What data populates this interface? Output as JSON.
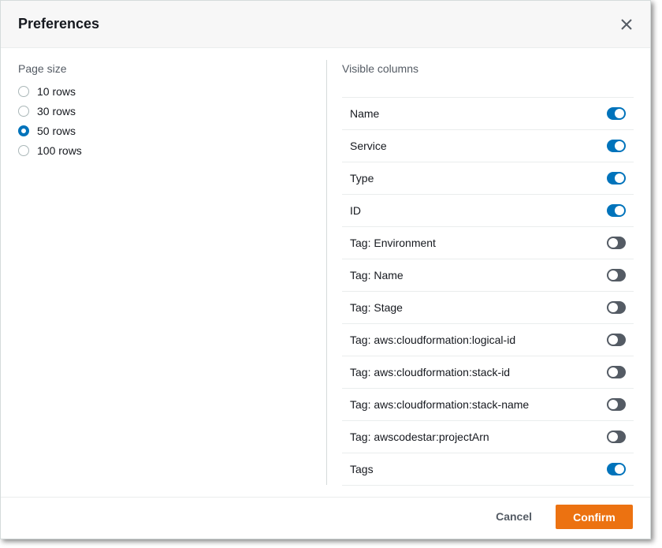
{
  "dialog": {
    "title": "Preferences",
    "close_icon": "close-icon"
  },
  "page_size": {
    "label": "Page size",
    "options": [
      {
        "label": "10 rows",
        "checked": false
      },
      {
        "label": "30 rows",
        "checked": false
      },
      {
        "label": "50 rows",
        "checked": true
      },
      {
        "label": "100 rows",
        "checked": false
      }
    ]
  },
  "visible_columns": {
    "label": "Visible columns",
    "columns": [
      {
        "label": "Name",
        "enabled": true
      },
      {
        "label": "Service",
        "enabled": true
      },
      {
        "label": "Type",
        "enabled": true
      },
      {
        "label": "ID",
        "enabled": true
      },
      {
        "label": "Tag: Environment",
        "enabled": false
      },
      {
        "label": "Tag: Name",
        "enabled": false
      },
      {
        "label": "Tag: Stage",
        "enabled": false
      },
      {
        "label": "Tag: aws:cloudformation:logical-id",
        "enabled": false
      },
      {
        "label": "Tag: aws:cloudformation:stack-id",
        "enabled": false
      },
      {
        "label": "Tag: aws:cloudformation:stack-name",
        "enabled": false
      },
      {
        "label": "Tag: awscodestar:projectArn",
        "enabled": false
      },
      {
        "label": "Tags",
        "enabled": true
      }
    ]
  },
  "footer": {
    "cancel_label": "Cancel",
    "confirm_label": "Confirm"
  },
  "colors": {
    "accent": "#0073bb",
    "toggle_off": "#545b64",
    "primary_button": "#ec7211"
  }
}
